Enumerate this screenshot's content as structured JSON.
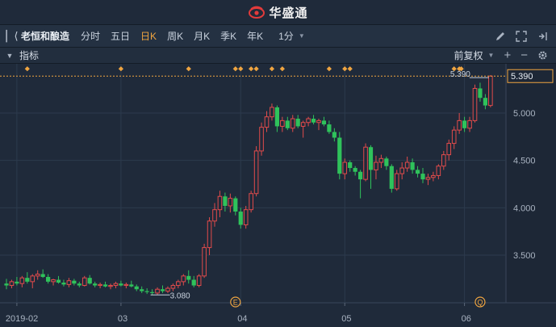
{
  "app": {
    "title": "华盛通"
  },
  "toolbar": {
    "collapse_icon": "collapse-left-icon",
    "stock_name": "老恒和酿造",
    "tabs": [
      {
        "label": "分时",
        "active": false
      },
      {
        "label": "五日",
        "active": false
      },
      {
        "label": "日K",
        "active": true
      },
      {
        "label": "周K",
        "active": false
      },
      {
        "label": "月K",
        "active": false
      },
      {
        "label": "季K",
        "active": false
      },
      {
        "label": "年K",
        "active": false
      }
    ],
    "minute_label": "1分",
    "right_icons": [
      "pencil-icon",
      "expand-icon",
      "pin-right-icon"
    ]
  },
  "subbar": {
    "indicator_label": "指标",
    "adjust_label": "前复权",
    "right_icons": [
      "plus-icon",
      "minus-icon",
      "gear-icon"
    ]
  },
  "colors": {
    "up": "#e24b4b",
    "down": "#2fc25b",
    "accent": "#f0a540",
    "grid": "#2c3a4d",
    "text": "#aab4c2"
  },
  "chart_data": {
    "type": "candlestick",
    "y_ticks": [
      5.0,
      4.5,
      4.0,
      3.5
    ],
    "y_tick_labels": [
      "5.000",
      "4.500",
      "4.000",
      "3.500"
    ],
    "y_range": [
      3.0,
      5.5
    ],
    "x_ticks": [
      {
        "index": 2,
        "label": "2019-02"
      },
      {
        "index": 22,
        "label": "03"
      },
      {
        "index": 45,
        "label": "04"
      },
      {
        "index": 65,
        "label": "05"
      },
      {
        "index": 88,
        "label": "06"
      }
    ],
    "last_price": 5.39,
    "last_price_label": "5.390",
    "max_label": "5.390",
    "min_label": "3.080",
    "event_markers": [
      {
        "index": 44,
        "label": "E"
      },
      {
        "index": 91,
        "label": "Q"
      }
    ],
    "diamond_indices": [
      4,
      22,
      35,
      44,
      45,
      47,
      48,
      51,
      53,
      62,
      65,
      66,
      86,
      87,
      88
    ],
    "candles": [
      [
        3.2,
        3.25,
        3.14,
        3.18
      ],
      [
        3.18,
        3.24,
        3.15,
        3.22
      ],
      [
        3.22,
        3.27,
        3.18,
        3.2
      ],
      [
        3.2,
        3.28,
        3.16,
        3.26
      ],
      [
        3.26,
        3.32,
        3.2,
        3.22
      ],
      [
        3.22,
        3.3,
        3.15,
        3.28
      ],
      [
        3.28,
        3.34,
        3.24,
        3.3
      ],
      [
        3.3,
        3.35,
        3.26,
        3.27
      ],
      [
        3.27,
        3.3,
        3.2,
        3.22
      ],
      [
        3.22,
        3.25,
        3.18,
        3.24
      ],
      [
        3.24,
        3.28,
        3.2,
        3.21
      ],
      [
        3.21,
        3.24,
        3.17,
        3.19
      ],
      [
        3.19,
        3.26,
        3.16,
        3.23
      ],
      [
        3.23,
        3.25,
        3.18,
        3.2
      ],
      [
        3.2,
        3.22,
        3.16,
        3.18
      ],
      [
        3.18,
        3.28,
        3.17,
        3.26
      ],
      [
        3.26,
        3.29,
        3.19,
        3.2
      ],
      [
        3.2,
        3.22,
        3.16,
        3.18
      ],
      [
        3.18,
        3.21,
        3.15,
        3.19
      ],
      [
        3.19,
        3.22,
        3.16,
        3.17
      ],
      [
        3.17,
        3.2,
        3.14,
        3.18
      ],
      [
        3.18,
        3.22,
        3.15,
        3.2
      ],
      [
        3.2,
        3.23,
        3.17,
        3.18
      ],
      [
        3.18,
        3.21,
        3.15,
        3.19
      ],
      [
        3.19,
        3.23,
        3.16,
        3.17
      ],
      [
        3.17,
        3.19,
        3.12,
        3.14
      ],
      [
        3.14,
        3.17,
        3.1,
        3.12
      ],
      [
        3.12,
        3.15,
        3.09,
        3.11
      ],
      [
        3.11,
        3.14,
        3.08,
        3.1
      ],
      [
        3.1,
        3.16,
        3.08,
        3.14
      ],
      [
        3.14,
        3.18,
        3.1,
        3.12
      ],
      [
        3.12,
        3.17,
        3.1,
        3.15
      ],
      [
        3.15,
        3.2,
        3.12,
        3.18
      ],
      [
        3.18,
        3.24,
        3.15,
        3.22
      ],
      [
        3.22,
        3.3,
        3.18,
        3.28
      ],
      [
        3.28,
        3.34,
        3.2,
        3.24
      ],
      [
        3.24,
        3.28,
        3.16,
        3.18
      ],
      [
        3.18,
        3.3,
        3.16,
        3.28
      ],
      [
        3.28,
        3.62,
        3.26,
        3.58
      ],
      [
        3.58,
        3.9,
        3.5,
        3.86
      ],
      [
        3.86,
        4.05,
        3.8,
        3.98
      ],
      [
        3.98,
        4.18,
        3.9,
        4.12
      ],
      [
        4.12,
        4.16,
        3.96,
        4.02
      ],
      [
        4.02,
        4.15,
        3.95,
        4.1
      ],
      [
        4.1,
        4.12,
        3.92,
        3.96
      ],
      [
        3.96,
        4.0,
        3.78,
        3.82
      ],
      [
        3.82,
        4.02,
        3.78,
        3.98
      ],
      [
        3.98,
        4.18,
        3.95,
        4.15
      ],
      [
        4.15,
        4.65,
        4.12,
        4.6
      ],
      [
        4.6,
        4.9,
        4.55,
        4.85
      ],
      [
        4.85,
        5.02,
        4.8,
        4.96
      ],
      [
        4.96,
        5.1,
        4.92,
        5.06
      ],
      [
        5.06,
        5.08,
        4.8,
        4.86
      ],
      [
        4.86,
        4.96,
        4.8,
        4.92
      ],
      [
        4.92,
        4.96,
        4.82,
        4.84
      ],
      [
        4.84,
        4.98,
        4.8,
        4.94
      ],
      [
        4.94,
        4.98,
        4.84,
        4.86
      ],
      [
        4.86,
        4.92,
        4.74,
        4.9
      ],
      [
        4.9,
        4.96,
        4.86,
        4.94
      ],
      [
        4.94,
        4.98,
        4.88,
        4.9
      ],
      [
        4.9,
        4.94,
        4.82,
        4.92
      ],
      [
        4.92,
        4.96,
        4.86,
        4.88
      ],
      [
        4.88,
        4.92,
        4.78,
        4.8
      ],
      [
        4.8,
        4.84,
        4.7,
        4.74
      ],
      [
        4.74,
        4.8,
        4.3,
        4.36
      ],
      [
        4.36,
        4.52,
        4.3,
        4.48
      ],
      [
        4.48,
        4.5,
        4.38,
        4.42
      ],
      [
        4.42,
        4.44,
        4.34,
        4.38
      ],
      [
        4.38,
        4.4,
        4.1,
        4.3
      ],
      [
        4.3,
        4.68,
        4.28,
        4.64
      ],
      [
        4.64,
        4.66,
        4.2,
        4.4
      ],
      [
        4.4,
        4.55,
        4.3,
        4.48
      ],
      [
        4.48,
        4.56,
        4.42,
        4.52
      ],
      [
        4.52,
        4.54,
        4.4,
        4.44
      ],
      [
        4.44,
        4.46,
        4.16,
        4.2
      ],
      [
        4.2,
        4.4,
        4.18,
        4.36
      ],
      [
        4.36,
        4.48,
        4.3,
        4.42
      ],
      [
        4.42,
        4.54,
        4.38,
        4.48
      ],
      [
        4.48,
        4.52,
        4.36,
        4.4
      ],
      [
        4.4,
        4.44,
        4.32,
        4.36
      ],
      [
        4.36,
        4.42,
        4.26,
        4.3
      ],
      [
        4.3,
        4.36,
        4.24,
        4.32
      ],
      [
        4.32,
        4.38,
        4.28,
        4.34
      ],
      [
        4.34,
        4.46,
        4.3,
        4.44
      ],
      [
        4.44,
        4.6,
        4.4,
        4.56
      ],
      [
        4.56,
        4.72,
        4.5,
        4.68
      ],
      [
        4.68,
        4.86,
        4.62,
        4.82
      ],
      [
        4.82,
        5.0,
        4.78,
        4.92
      ],
      [
        4.92,
        4.96,
        4.8,
        4.84
      ],
      [
        4.84,
        4.96,
        4.8,
        4.92
      ],
      [
        4.92,
        5.3,
        4.9,
        5.26
      ],
      [
        5.26,
        5.32,
        5.12,
        5.16
      ],
      [
        5.16,
        5.2,
        5.04,
        5.08
      ],
      [
        5.08,
        5.4,
        5.06,
        5.39
      ]
    ]
  }
}
